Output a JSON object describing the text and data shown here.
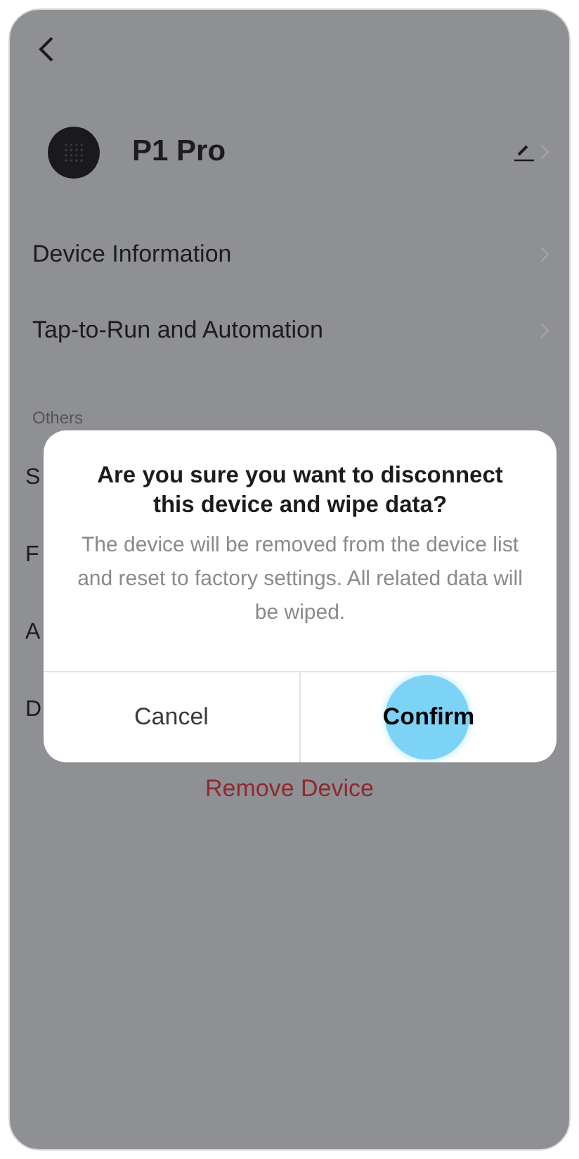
{
  "device": {
    "name": "P1 Pro"
  },
  "menu": [
    {
      "label": "Device Information"
    },
    {
      "label": "Tap-to-Run and Automation"
    }
  ],
  "section": {
    "title": "Others"
  },
  "others": [
    {
      "label": "S"
    },
    {
      "label": "F"
    },
    {
      "label": "A"
    },
    {
      "label": "D"
    }
  ],
  "remove": {
    "label": "Remove Device"
  },
  "dialog": {
    "title": "Are you sure you want to disconnect this device and wipe data?",
    "message": "The device will be removed from the device list and reset to factory settings. All related data will be wiped.",
    "buttons": [
      {
        "label": "Cancel",
        "kind": "cancel",
        "pressed": false
      },
      {
        "label": "Confirm",
        "kind": "confirm",
        "pressed": true
      }
    ]
  }
}
